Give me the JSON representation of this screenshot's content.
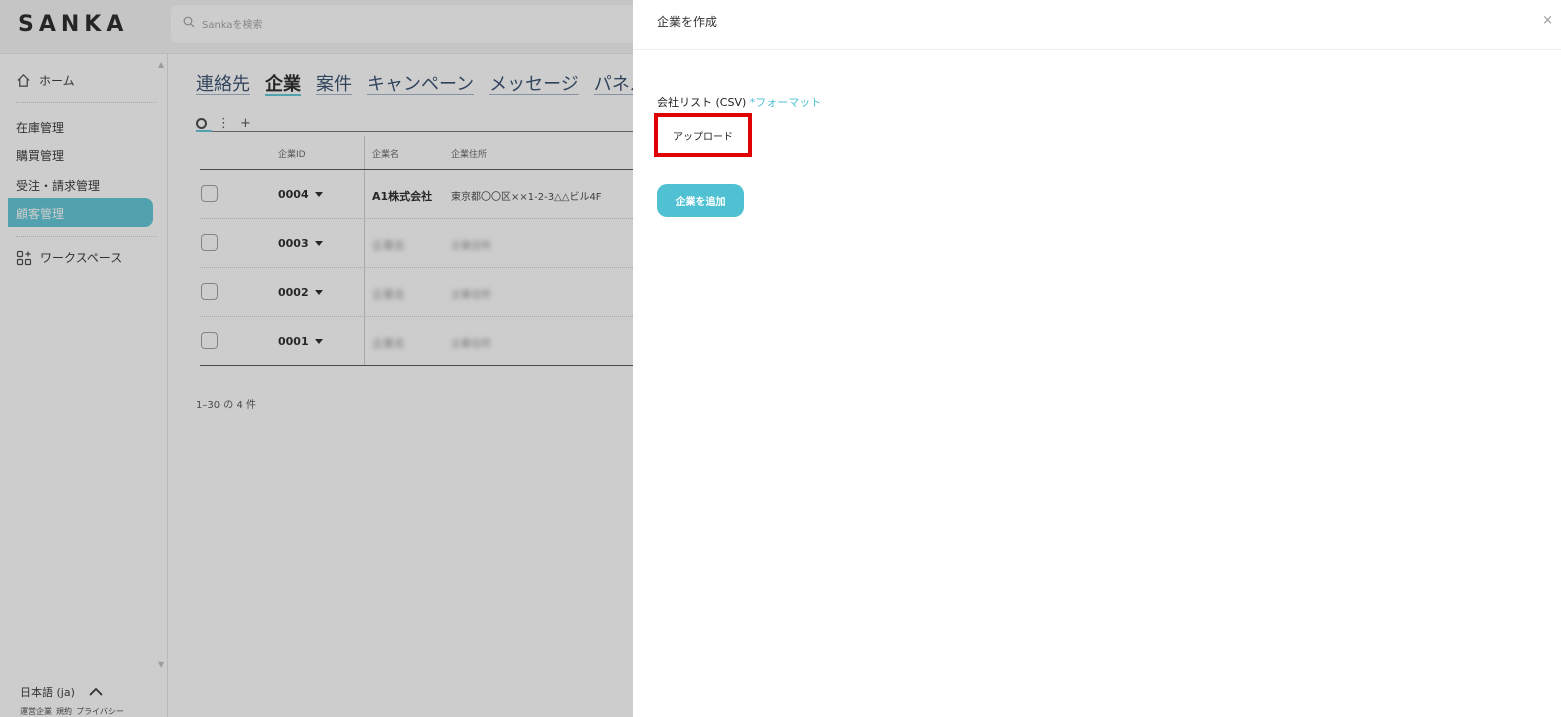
{
  "app": {
    "logo": "SANKA"
  },
  "search": {
    "placeholder": "Sankaを検索"
  },
  "sidebar": {
    "home_label": "ホーム",
    "items": [
      {
        "label": "在庫管理"
      },
      {
        "label": "購買管理"
      },
      {
        "label": "受注・請求管理"
      },
      {
        "label": "顧客管理",
        "active": true
      }
    ],
    "workspace_label": "ワークスペース",
    "language": "日本語 (ja)",
    "footer_links": [
      "運営企業",
      "規約",
      "プライバシー"
    ]
  },
  "main": {
    "tabs": [
      {
        "label": "連絡先"
      },
      {
        "label": "企業",
        "active": true
      },
      {
        "label": "案件"
      },
      {
        "label": "キャンペーン"
      },
      {
        "label": "メッセージ"
      },
      {
        "label": "パネル"
      }
    ],
    "toolbar": {
      "more": "⋮",
      "add": "+"
    },
    "table": {
      "columns": [
        "企業ID",
        "企業名",
        "企業住所"
      ],
      "rows": [
        {
          "id": "0004",
          "name": "A1株式会社",
          "address": "東京都〇〇区××1-2-3△△ビル4F"
        },
        {
          "id": "0003",
          "name": "企業名",
          "address": "企業住所"
        },
        {
          "id": "0002",
          "name": "企業名",
          "address": "企業住所"
        },
        {
          "id": "0001",
          "name": "企業名",
          "address": "企業住所"
        }
      ]
    },
    "pagination": "1–30 の 4 件"
  },
  "drawer": {
    "title": "企業を作成",
    "close": "×",
    "field_label": "会社リスト (CSV)",
    "required_mark": "*",
    "format_link": "フォーマット",
    "upload_label": "アップロード",
    "submit_label": "企業を追加"
  },
  "colors": {
    "accent": "#4fc1d3",
    "highlight": "#e00000"
  }
}
